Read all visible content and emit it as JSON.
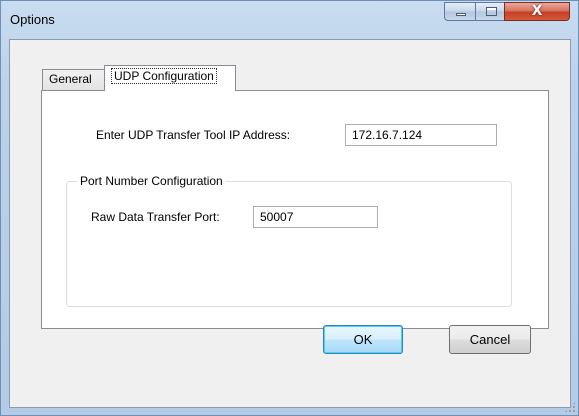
{
  "window": {
    "title": "Options",
    "caption_buttons": {
      "minimize": "minimize-icon",
      "maximize": "maximize-icon",
      "close": "close-icon",
      "close_glyph": "X"
    }
  },
  "tabs": [
    {
      "label": "General",
      "active": false
    },
    {
      "label": "UDP Configuration",
      "active": true
    }
  ],
  "udp": {
    "ip_label": "Enter UDP Transfer Tool IP Address:",
    "ip_value": "172.16.7.124",
    "port_group": {
      "caption": "Port Number Configuration",
      "raw_port_label": "Raw Data Transfer Port:",
      "raw_port_value": "50007"
    }
  },
  "buttons": {
    "ok": "OK",
    "cancel": "Cancel"
  },
  "colors": {
    "title_bar": "#bcd2eb",
    "close_button": "#c53f25",
    "default_button_accent": "#3c7fb1",
    "dialog_background": "#f0f0f0"
  }
}
